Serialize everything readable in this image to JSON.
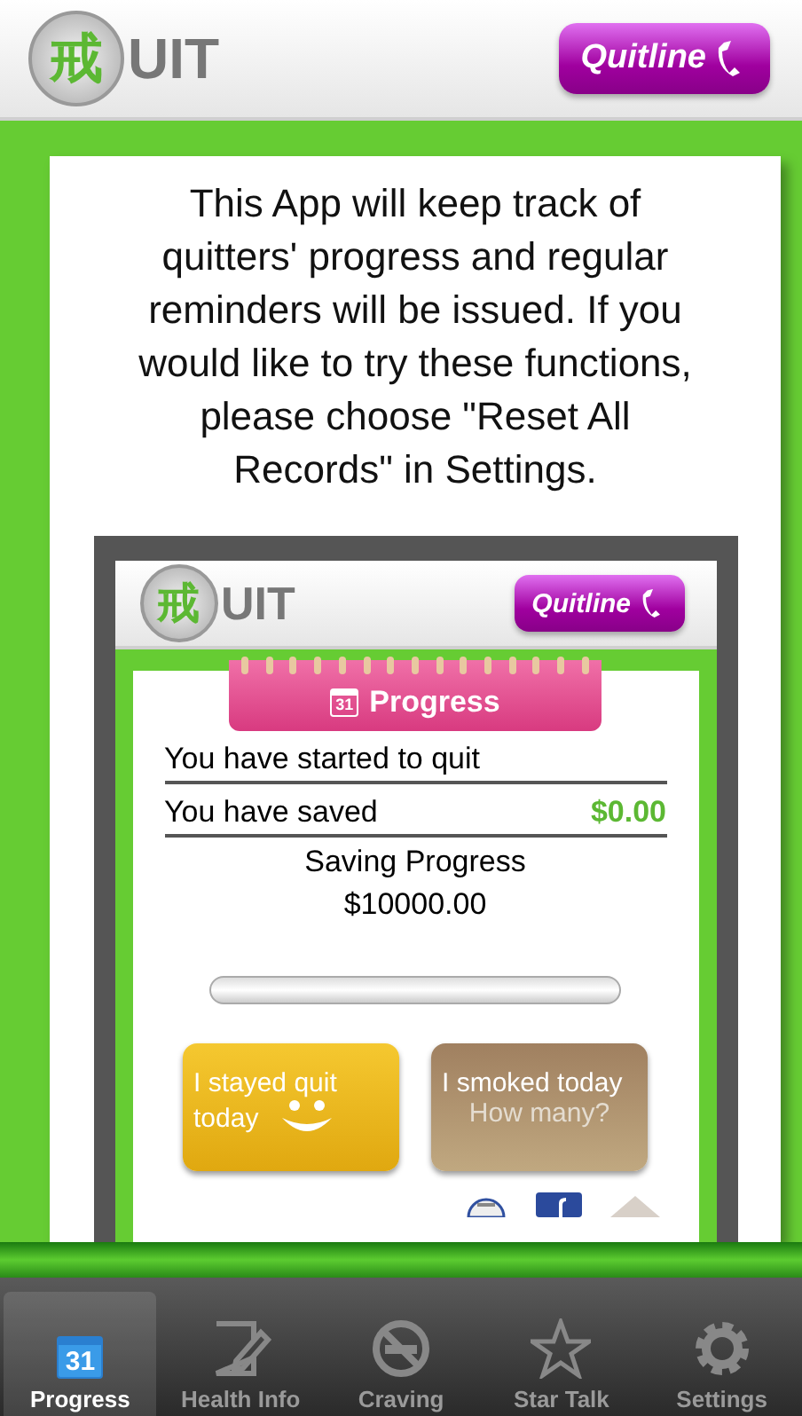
{
  "header": {
    "logo_char": "戒",
    "logo_text": "UIT",
    "quitline": "Quitline"
  },
  "notice": "This App will keep track of quitters' progress and regular reminders will be issued. If you would like to try these functions, please choose \"Reset All Records\" in Settings.",
  "preview": {
    "header": {
      "logo_char": "戒",
      "logo_text": "UIT",
      "quitline": "Quitline"
    },
    "title": {
      "day": "31",
      "label": "Progress"
    },
    "rows": [
      {
        "label": "You have started to quit",
        "value": null
      },
      {
        "label": "You have saved",
        "value": "$0.00"
      }
    ],
    "goal_label": "Saving Progress",
    "goal_amount": "$10000.00",
    "progress": {
      "level": 0
    },
    "buttons": [
      {
        "kind": "quit",
        "lines": [
          "I stayed quit",
          "today"
        ]
      },
      {
        "kind": "smoked",
        "lines": [
          "I smoked today",
          "How many?"
        ]
      }
    ]
  },
  "tabs": [
    {
      "kind": "calendar",
      "day": "31",
      "label": "Progress",
      "selected": true
    },
    {
      "kind": "notepad",
      "label": "Health Info",
      "selected": false
    },
    {
      "kind": "nosmoking",
      "label": "Craving",
      "selected": false
    },
    {
      "kind": "star",
      "label": "Star Talk",
      "selected": false
    },
    {
      "kind": "gear",
      "label": "Settings",
      "selected": false
    }
  ]
}
